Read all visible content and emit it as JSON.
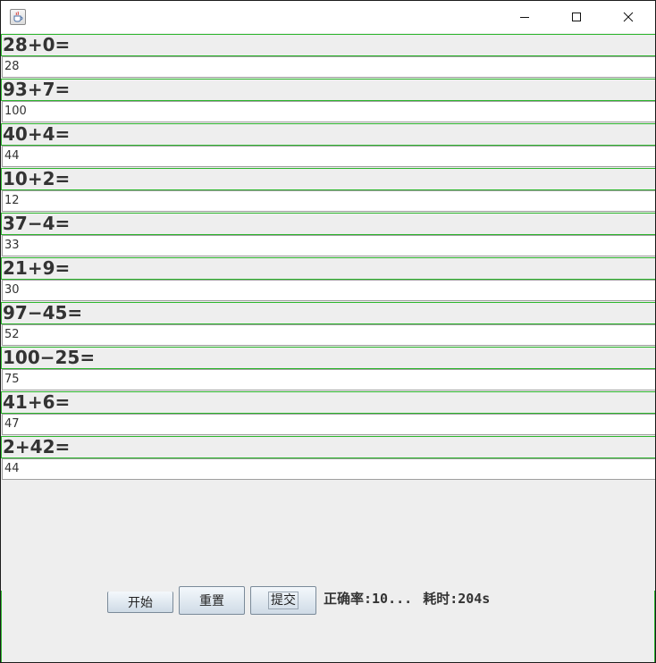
{
  "window": {
    "icon": "java-cup-icon",
    "controls": {
      "minimize": "minimize-icon",
      "maximize": "maximize-icon",
      "close": "close-icon"
    }
  },
  "questions": [
    {
      "question": "28+0=",
      "answer": "28"
    },
    {
      "question": "93+7=",
      "answer": "100"
    },
    {
      "question": "40+4=",
      "answer": "44"
    },
    {
      "question": "10+2=",
      "answer": "12"
    },
    {
      "question": "37−4=",
      "answer": "33"
    },
    {
      "question": "21+9=",
      "answer": "30"
    },
    {
      "question": "97−45=",
      "answer": "52"
    },
    {
      "question": "100−25=",
      "answer": "75"
    },
    {
      "question": "41+6=",
      "answer": "47"
    },
    {
      "question": "2+42=",
      "answer": "44"
    }
  ],
  "buttons": {
    "start": "开始",
    "reset": "重置",
    "submit": "提交"
  },
  "status": {
    "accuracy": "正确率:10...",
    "elapsed": "耗时:204s"
  },
  "colors": {
    "accent_border": "#2db62d",
    "panel_bg": "#eeeeee",
    "text": "#333333"
  }
}
